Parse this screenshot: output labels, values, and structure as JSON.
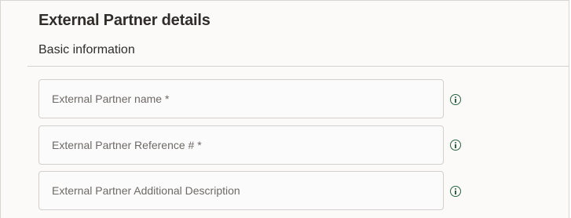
{
  "header": {
    "title": "External Partner details"
  },
  "section": {
    "title": "Basic information"
  },
  "fields": [
    {
      "placeholder": "External Partner name *",
      "value": ""
    },
    {
      "placeholder": "External Partner Reference # *",
      "value": ""
    },
    {
      "placeholder": "External Partner Additional Description",
      "value": ""
    }
  ],
  "icons": {
    "info": "info-icon"
  },
  "colors": {
    "info_icon": "#2b6242",
    "background": "#fbfaf9",
    "field_border": "#d2cfcc"
  }
}
